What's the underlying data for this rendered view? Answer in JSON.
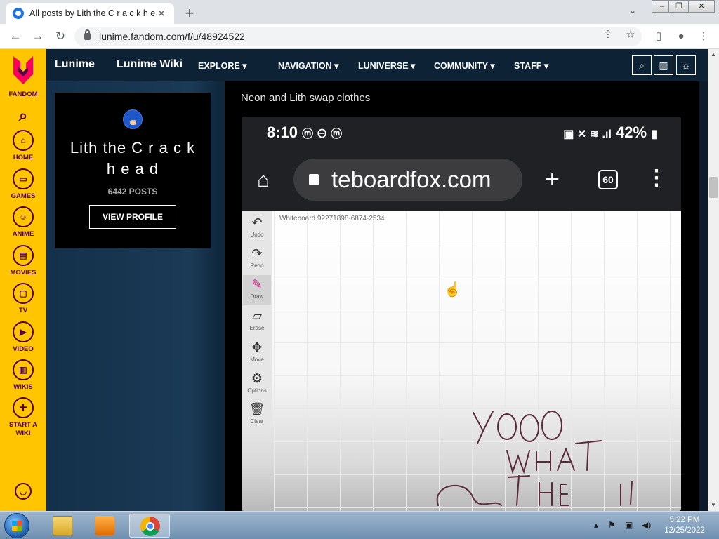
{
  "browser": {
    "tab_title": "All posts by Lith the C r a c k h e",
    "url": "lunime.fandom.com/f/u/48924522"
  },
  "fandom_rail": {
    "brand": "FANDOM",
    "items": [
      {
        "label": "HOME"
      },
      {
        "label": "GAMES"
      },
      {
        "label": "ANIME"
      },
      {
        "label": "MOVIES"
      },
      {
        "label": "TV"
      },
      {
        "label": "VIDEO"
      },
      {
        "label": "WIKIS"
      },
      {
        "label": "START A WIKI"
      }
    ]
  },
  "wiki_nav": {
    "logo": "Lunime",
    "wiki_name": "Lunime Wiki",
    "links": [
      "EXPLORE",
      "NAVIGATION",
      "LUNIVERSE",
      "COMMUNITY",
      "STAFF"
    ]
  },
  "profile": {
    "name": "Lith the C r a c k h e a d",
    "posts": "6442 POSTS",
    "button": "VIEW PROFILE"
  },
  "post": {
    "title": "Neon and Lith swap clothes"
  },
  "phone": {
    "time": "8:10",
    "battery": "42%",
    "url": "teboardfox.com",
    "tab_count": "60",
    "board_label": "Whiteboard 92271898-6874-2534",
    "tools": [
      "Undo",
      "Redo",
      "Draw",
      "Erase",
      "Move",
      "Options",
      "Clear"
    ]
  },
  "taskbar": {
    "time": "5:22 PM",
    "date": "12/25/2022"
  }
}
